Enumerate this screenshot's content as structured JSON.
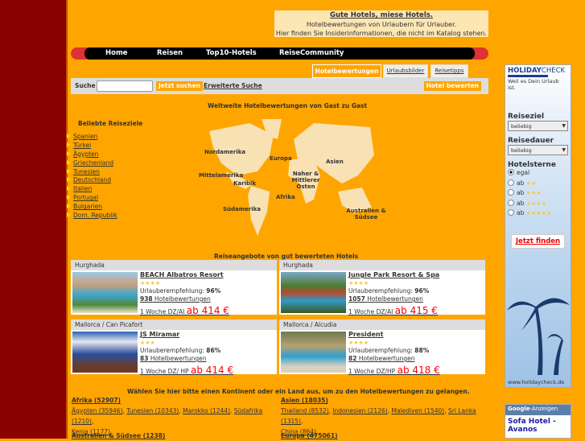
{
  "tagline": {
    "title": "Gute Hotels, miese Hotels.",
    "line1": "Hotelbewertungen von Urlaubern für Urlauber.",
    "line2": "Hier finden Sie Insiderinformationen, die nicht im Katalog stehen."
  },
  "nav": [
    "Home",
    "Reisen",
    "Top10-Hotels",
    "ReiseCommunity"
  ],
  "tabs": [
    "Hotelbewertungen",
    "Urlaubsbilder",
    "Reisetipps"
  ],
  "search": {
    "label": "Suche",
    "value": "",
    "button": "Jetzt suchen",
    "advanced": "Erweiterte Suche",
    "rate": "Hotel bewerten"
  },
  "map": {
    "title": "Weltweite Hotelbewertungen von Gast zu Gast",
    "regions": [
      "Nordamerika",
      "Mittelamerika",
      "Karibik",
      "Südamerika",
      "Europa",
      "Naher & Mittlerer Osten",
      "Afrika",
      "Asien",
      "Australien & Südsee"
    ]
  },
  "destinations": {
    "title": "Beliebte Reiseziele",
    "items": [
      "Spanien",
      "Türkei",
      "Ägypten",
      "Griechenland",
      "Tunesien",
      "Deutschland",
      "Italien",
      "Portugal",
      "Bulgarien",
      "Dom. Republik"
    ]
  },
  "offers": {
    "title": "Reiseangebote von gut bewerteten Hotels",
    "cards": [
      {
        "location": "Hurghada",
        "name": "BEACH Albatros Resort",
        "stars": "★★★★",
        "rec_label": "Urlauberempfehlung:",
        "rec": "96%",
        "reviews": "938",
        "reviews_label": "Hotelbewertungen",
        "trip": "1 Woche DZ/AI",
        "price": "ab 414 €"
      },
      {
        "location": "Hurghada",
        "name": "Jungle Park Resort & Spa",
        "stars": "★★★★",
        "rec_label": "Urlauberempfehlung:",
        "rec": "96%",
        "reviews": "1057",
        "reviews_label": "Hotelbewertungen",
        "trip": "1 Woche DZ/AI",
        "price": "ab 415 €"
      },
      {
        "location": "Mallorca / Can Picafort",
        "name": "JS Miramar",
        "stars": "★★★",
        "rec_label": "Urlauberempfehlung:",
        "rec": "86%",
        "reviews": "83",
        "reviews_label": "Hotelbewertungen",
        "trip": "1 Woche DZ/ HP",
        "price": "ab 414 €"
      },
      {
        "location": "Mallorca / Alcudia",
        "name": "President",
        "stars": "★★★★",
        "rec_label": "Urlauberempfehlung:",
        "rec": "88%",
        "reviews": "82",
        "reviews_label": "Hotelbewertungen",
        "trip": "1 Woche DZ/HP",
        "price": "ab 418 €"
      }
    ]
  },
  "continents": {
    "intro": "Wählen Sie hier bitte einen Kontinent oder ein Land aus, um zu den Hotelbewertungen zu gelangen.",
    "afrika": {
      "title": "Afrika (52907)",
      "countries": [
        "Ägypten (35946)",
        "Tunesien (10343)",
        "Marokko (1244)",
        "Südafrika (1210)",
        "Kenia (1177)"
      ]
    },
    "asien": {
      "title": "Asien (18035)",
      "countries": [
        "Thailand (8532)",
        "Indonesien (2126)",
        "Malediven (1540)",
        "Sri Lanka (1315)",
        "China (864)"
      ]
    },
    "australien": {
      "title": "Australien & Südsee (1238)"
    },
    "europa": {
      "title": "Europa (475061)"
    }
  },
  "sidebar": {
    "logo_a": "HOLIDAY",
    "logo_b": "CHECK",
    "slogan": "Weil es Dein Urlaub ist.",
    "reiseziel": "Reiseziel",
    "reiseziel_value": "beliebig",
    "reisedauer": "Reisedauer",
    "reisedauer_value": "beliebig",
    "sterne": "Hotelsterne",
    "options": [
      {
        "label": "egal",
        "stars": ""
      },
      {
        "label": "ab",
        "stars": "★★"
      },
      {
        "label": "ab",
        "stars": "★★★"
      },
      {
        "label": "ab",
        "stars": "★★★★"
      },
      {
        "label": "ab",
        "stars": "★★★★★"
      }
    ],
    "button": "Jetzt finden",
    "url": "www.holidaycheck.de"
  },
  "google": {
    "brand": "Google",
    "label": "-Anzeigen",
    "ad": "Sofa Hotel - Avanos"
  }
}
